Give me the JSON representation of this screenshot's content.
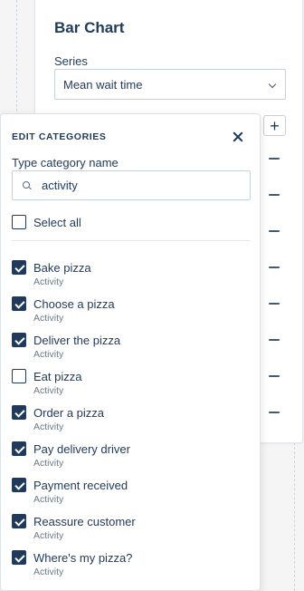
{
  "chart_panel": {
    "title": "Bar Chart",
    "series_label": "Series",
    "series_value": "Mean wait time",
    "add_button_label": "+"
  },
  "popover": {
    "header": "EDIT CATEGORIES",
    "field_label": "Type category name",
    "search_value": "activity",
    "select_all_label": "Select all",
    "select_all_checked": false,
    "items": [
      {
        "label": "Bake pizza",
        "sub": "Activity",
        "checked": true
      },
      {
        "label": "Choose a pizza",
        "sub": "Activity",
        "checked": true
      },
      {
        "label": "Deliver the pizza",
        "sub": "Activity",
        "checked": true
      },
      {
        "label": "Eat pizza",
        "sub": "Activity",
        "checked": false
      },
      {
        "label": "Order a pizza",
        "sub": "Activity",
        "checked": true
      },
      {
        "label": "Pay delivery driver",
        "sub": "Activity",
        "checked": true
      },
      {
        "label": "Payment received",
        "sub": "Activity",
        "checked": true
      },
      {
        "label": "Reassure customer",
        "sub": "Activity",
        "checked": true
      },
      {
        "label": "Where's my pizza?",
        "sub": "Activity",
        "checked": true
      }
    ]
  },
  "colors": {
    "accent": "#1f3a5c",
    "muted_text": "#6b7a8a",
    "border": "#c9cfd6"
  }
}
